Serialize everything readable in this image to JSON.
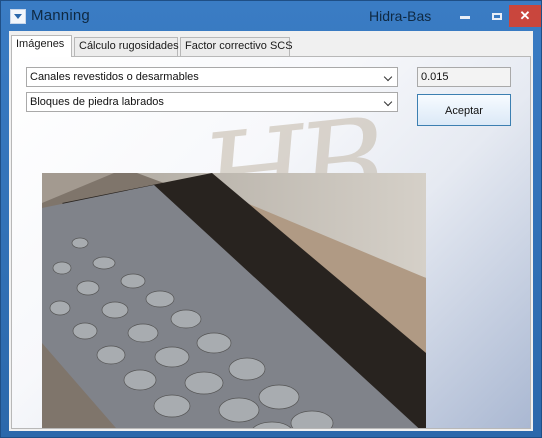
{
  "window": {
    "title": "Manning",
    "app_name": "Hidra-Bas",
    "minimize_icon": "minimize-icon",
    "maximize_icon": "maximize-icon",
    "close_icon": "close-icon",
    "close_symbol": "✕"
  },
  "tabs": [
    {
      "label": "Imágenes",
      "active": true
    },
    {
      "label": "Cálculo rugosidades",
      "active": false
    },
    {
      "label": "Factor correctivo SCS",
      "active": false
    }
  ],
  "form": {
    "channel_type": "Canales revestidos o desarmables",
    "material": "Bloques de piedra labrados",
    "coefficient": "0.015",
    "accept_label": "Aceptar"
  },
  "watermark": "HB",
  "image": {
    "subject": "stone-lined-channel-photo"
  }
}
